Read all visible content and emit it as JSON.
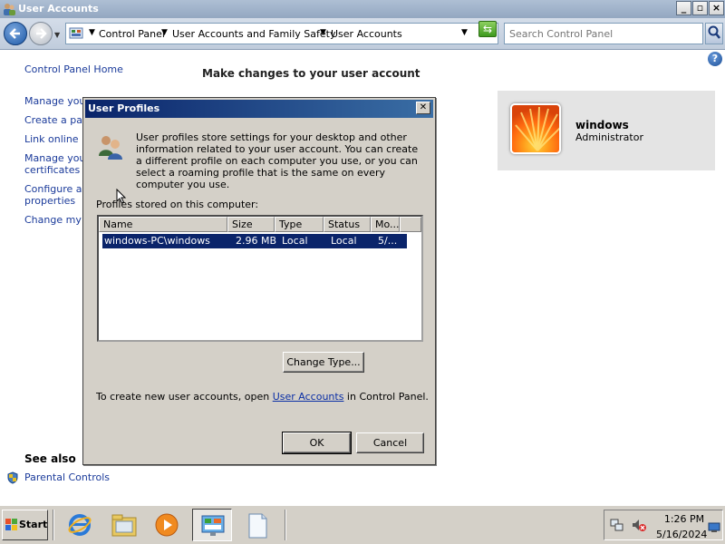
{
  "window": {
    "title": "User Accounts"
  },
  "address": {
    "crumbs": [
      "Control Panel",
      "User Accounts and Family Safety",
      "User Accounts"
    ],
    "search_placeholder": "Search Control Panel"
  },
  "sidebar": {
    "links": [
      "Control Panel Home",
      "Manage your",
      "Create a pas",
      "Link online ID",
      "Manage your",
      "certificates",
      "Configure adv",
      "properties",
      "Change my e"
    ],
    "see_also": "See also",
    "parental_controls": "Parental Controls"
  },
  "main": {
    "heading": "Make changes to your user account",
    "user_name": "windows",
    "user_role": "Administrator"
  },
  "dialog": {
    "title": "User Profiles",
    "description": "User profiles store settings for your desktop and other information related to your user account. You can create a different profile on each computer you use, or you can select a roaming profile that is the same on every computer you use.",
    "profiles_label": "Profiles stored on this computer:",
    "columns": [
      "Name",
      "Size",
      "Type",
      "Status",
      "Mo..."
    ],
    "rows": [
      {
        "name": "windows-PC\\windows",
        "size": "2.96 MB",
        "type": "Local",
        "status": "Local",
        "modified": "5/..."
      }
    ],
    "change_type_label": "Change Type...",
    "bottom_text_before": "To create new user accounts, open ",
    "bottom_link": "User Accounts",
    "bottom_text_after": " in Control Panel.",
    "ok_label": "OK",
    "cancel_label": "Cancel"
  },
  "taskbar": {
    "start_label": "Start",
    "time": "1:26 PM",
    "date": "5/16/2024"
  }
}
